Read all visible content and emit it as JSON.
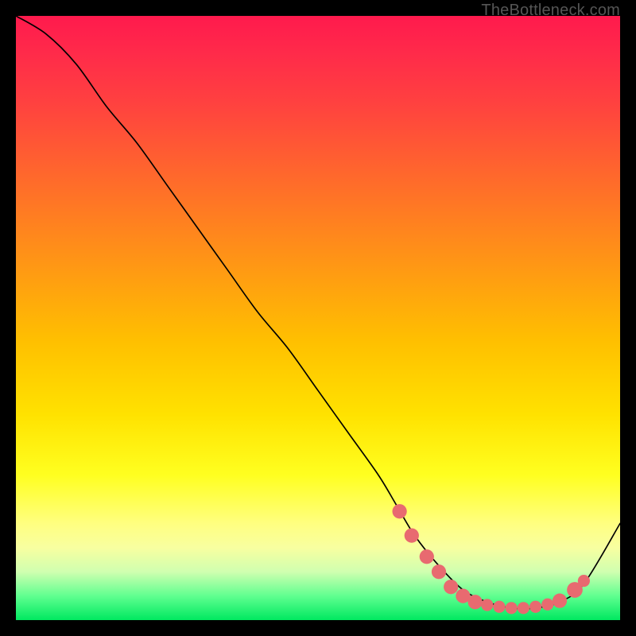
{
  "watermark": "TheBottleneck.com",
  "chart_data": {
    "type": "line",
    "title": "",
    "xlabel": "",
    "ylabel": "",
    "xlim": [
      0,
      100
    ],
    "ylim": [
      0,
      100
    ],
    "series": [
      {
        "name": "bottleneck-curve",
        "x": [
          0,
          5,
          10,
          15,
          20,
          25,
          30,
          35,
          40,
          45,
          50,
          55,
          60,
          63,
          66,
          70,
          74,
          78,
          82,
          86,
          90,
          94,
          100
        ],
        "y": [
          100,
          97,
          92,
          85,
          79,
          72,
          65,
          58,
          51,
          45,
          38,
          31,
          24,
          19,
          14,
          9,
          5,
          3,
          2,
          2,
          3,
          6,
          16
        ]
      }
    ],
    "markers": {
      "name": "highlight-dots",
      "color": "#e86a70",
      "x": [
        63.5,
        65.5,
        68.0,
        70.0,
        72.0,
        74.0,
        76.0,
        78.0,
        80.0,
        82.0,
        84.0,
        86.0,
        88.0,
        90.0,
        92.5,
        94.0
      ],
      "y": [
        18.0,
        14.0,
        10.5,
        8.0,
        5.5,
        4.0,
        3.0,
        2.5,
        2.2,
        2.0,
        2.0,
        2.2,
        2.6,
        3.2,
        5.0,
        6.5
      ],
      "r": [
        1.2,
        1.2,
        1.2,
        1.2,
        1.2,
        1.2,
        1.2,
        1.0,
        1.0,
        1.0,
        1.0,
        1.0,
        1.0,
        1.2,
        1.3,
        1.0
      ]
    },
    "background_gradient_stops": [
      {
        "pos": 0.0,
        "color": "#ff1a4d"
      },
      {
        "pos": 0.24,
        "color": "#ff6030"
      },
      {
        "pos": 0.54,
        "color": "#ffc000"
      },
      {
        "pos": 0.76,
        "color": "#ffff20"
      },
      {
        "pos": 0.92,
        "color": "#d0ffb0"
      },
      {
        "pos": 1.0,
        "color": "#00e860"
      }
    ]
  }
}
